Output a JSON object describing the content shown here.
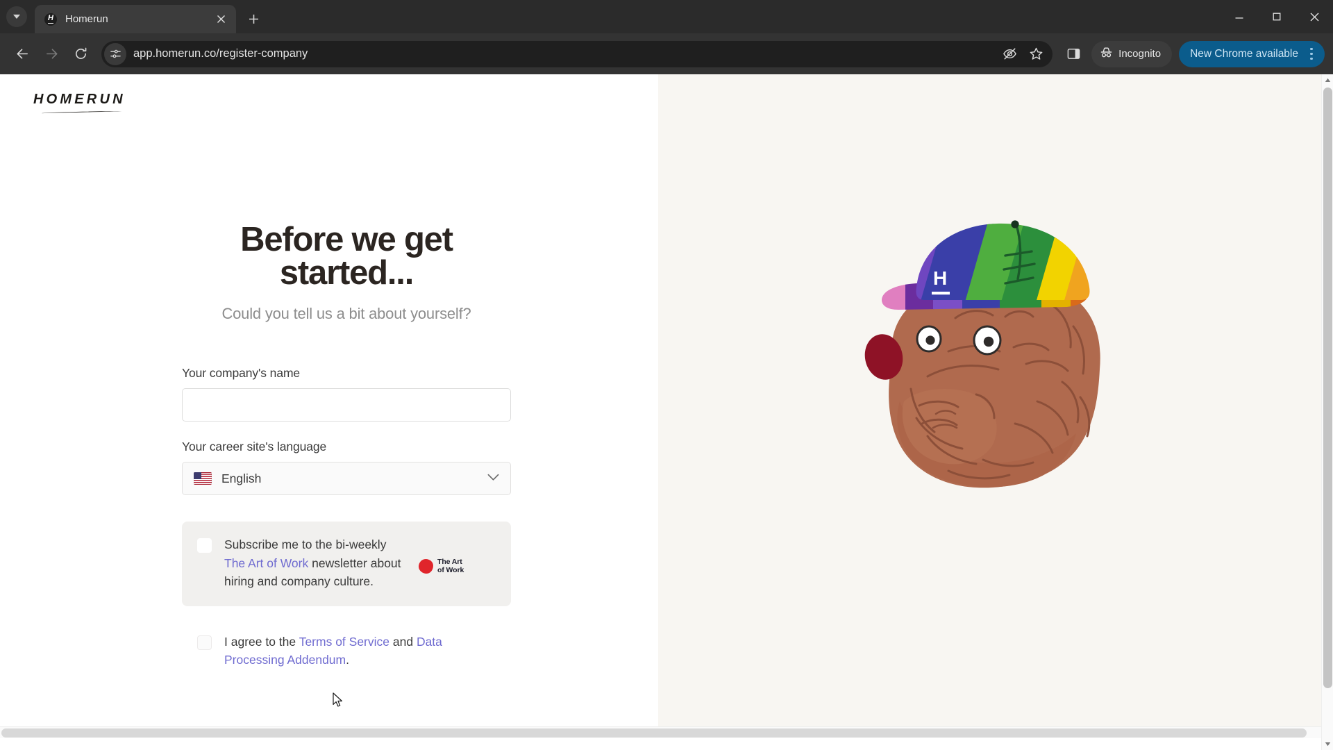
{
  "browser": {
    "tab": {
      "title": "Homerun",
      "favicon_letter": "H",
      "favicon_name": "homerun-favicon"
    },
    "new_tab_label": "+",
    "url": "app.homerun.co/register-company",
    "toolbar": {
      "back_icon": "back-arrow-icon",
      "forward_icon": "forward-arrow-icon",
      "reload_icon": "reload-icon",
      "site_info_icon": "site-settings-icon",
      "tracking_icon": "eye-off-icon",
      "bookmark_icon": "star-icon",
      "side_panel_icon": "side-panel-icon",
      "incognito_label": "Incognito",
      "incognito_icon": "incognito-hat-icon",
      "update_label": "New Chrome available",
      "menu_icon": "three-dot-menu-icon"
    },
    "window": {
      "minimize_label": "Minimize",
      "maximize_label": "Maximize",
      "close_label": "Close"
    }
  },
  "page": {
    "brand": {
      "wordmark": "HOMERUN"
    },
    "headline": "Before we get started...",
    "subhead": "Could you tell us a bit about yourself?",
    "fields": {
      "company": {
        "label": "Your company's name",
        "value": "",
        "placeholder": ""
      },
      "language": {
        "label": "Your career site's language",
        "value": "English",
        "flag": "us-flag-icon",
        "chevron": "chevron-down-icon"
      }
    },
    "newsletter": {
      "text_before": "Subscribe me to the bi-weekly ",
      "link": "The Art of Work",
      "text_after": " newsletter about hiring and company culture.",
      "checked": false,
      "logo_line1": "The Art",
      "logo_line2": "of Work",
      "logo_color": "#e0252b",
      "card_bg": "#f1f0ee"
    },
    "terms": {
      "text_before": "I agree to the ",
      "link1": "Terms of Service",
      "text_middle": " and ",
      "link2": "Data Processing Addendum",
      "text_after": ".",
      "checked": false
    },
    "illustration": {
      "name": "bulldog-with-rainbow-cap",
      "cap_letter": "H",
      "dog_color": "#b06a4e",
      "panel_bg": "#f8f6f2"
    },
    "colors": {
      "link": "#6f6bd0",
      "heading": "#2b2521",
      "subhead": "#8d8d8d"
    }
  }
}
